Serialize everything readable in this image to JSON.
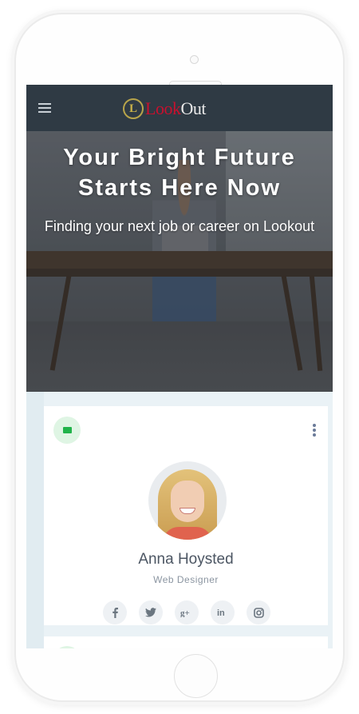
{
  "navbar": {
    "menu_icon": "hamburger-icon",
    "logo_mark": "L",
    "logo_look": "Look",
    "logo_out": "Out"
  },
  "hero": {
    "title": "Your Bright Future Starts Here Now",
    "subtitle": "Finding your next job or career on Lookout"
  },
  "profile_card": {
    "badge_icon": "envelope-icon",
    "menu_icon": "kebab-menu-icon",
    "name": "Anna Hoysted",
    "role": "Web Designer",
    "socials": [
      {
        "name": "facebook",
        "glyph": "f"
      },
      {
        "name": "twitter",
        "glyph": "t"
      },
      {
        "name": "google-plus",
        "glyph": "g+"
      },
      {
        "name": "linkedin",
        "glyph": "in"
      },
      {
        "name": "instagram",
        "glyph": "ig"
      }
    ]
  },
  "colors": {
    "navbar_bg": "#2f3a44",
    "logo_look": "#c8102e",
    "badge_green": "#21b34a",
    "content_bg": "#eaf2f6"
  }
}
